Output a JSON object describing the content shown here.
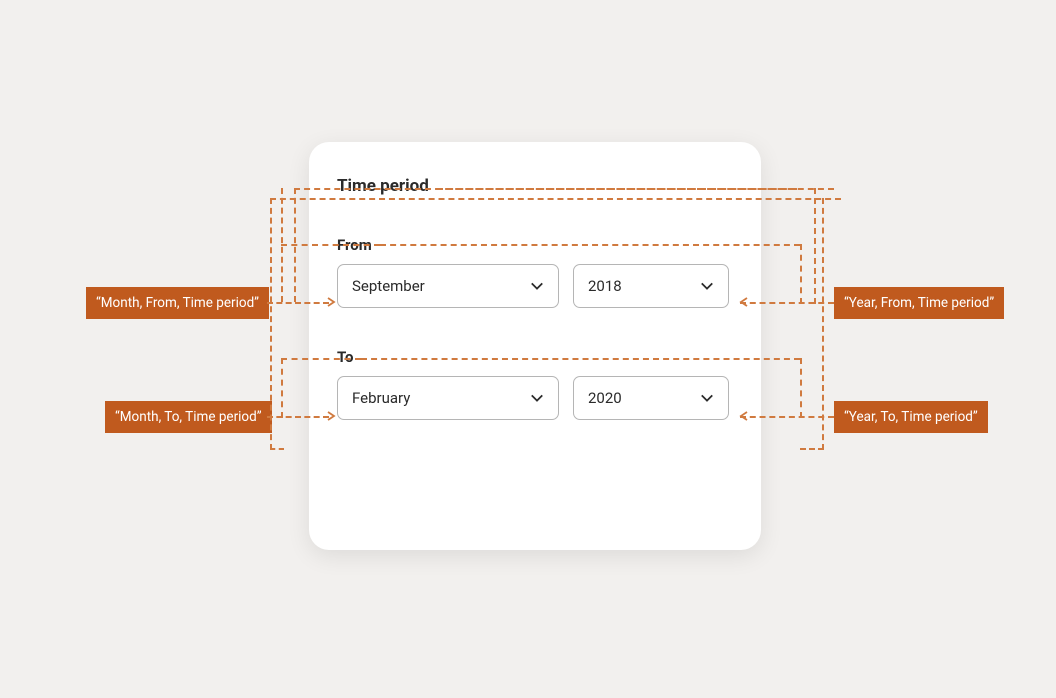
{
  "card": {
    "title": "Time period",
    "from": {
      "label": "From",
      "month": "September",
      "year": "2018"
    },
    "to": {
      "label": "To",
      "month": "February",
      "year": "2020"
    }
  },
  "annotations": {
    "month_from": "“Month, From, Time period”",
    "year_from": "“Year, From, Time period”",
    "month_to": "“Month, To, Time period”",
    "year_to": "“Year, To, Time period”"
  },
  "colors": {
    "accent": "#c05a1e",
    "dash": "#d07a3f"
  }
}
